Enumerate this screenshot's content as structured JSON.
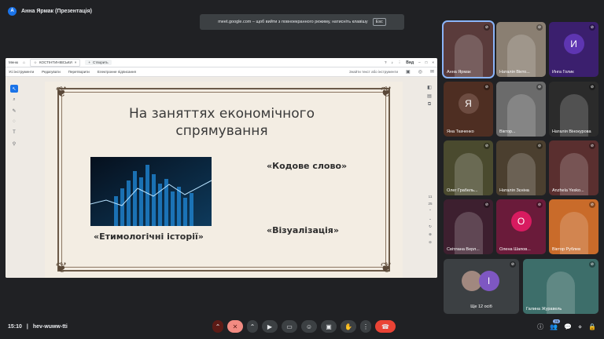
{
  "top": {
    "avatar_letter": "A",
    "presenter": "Анна Ярмак (Презентація)"
  },
  "banner": {
    "text": "meet.google.com – щоб вийти з повноекранного режиму, натисніть клавішу",
    "key": "Esc"
  },
  "browser": {
    "menu_label": "Меню",
    "tab_title": "КОСТІНТИНІВСЬКИ",
    "new_tab": "Створить",
    "view_label": "Вид",
    "menu_items": [
      "Усі інструменти",
      "Редагувати",
      "Перетворити",
      "Електронне підписання"
    ],
    "search_placeholder": "Знайти текст або інструменти",
    "page_current": "11",
    "page_total": "25"
  },
  "slide": {
    "title_line1": "На заняттях економічного",
    "title_line2": "спрямування",
    "caption_code": "«Кодове слово»",
    "caption_etym": "«Етимологічні історії»",
    "caption_visual": "«Візуалізація»"
  },
  "participants": [
    {
      "name": "Анна Ярмак",
      "type": "photo",
      "bg": "#5a3b3b"
    },
    {
      "name": "Наталія Вікто...",
      "type": "photo",
      "bg": "#8a7f72"
    },
    {
      "name": "Инга Голик",
      "type": "letter",
      "letter": "И",
      "bg": "#3b1f6e",
      "circle": "#5e35b1"
    },
    {
      "name": "Яна Ткаченко",
      "type": "letter",
      "letter": "Я",
      "bg": "#4e2e22",
      "circle": "#6d4c41"
    },
    {
      "name": "Віктор...",
      "type": "photo",
      "bg": "#6b6b6b"
    },
    {
      "name": "Наталія Вінокурова",
      "type": "photo",
      "bg": "#2b2b2b"
    },
    {
      "name": "Олег Грабель...",
      "type": "photo",
      "bg": "#4a4a2e"
    },
    {
      "name": "Наталія Зєніна",
      "type": "photo",
      "bg": "#4b3f2f"
    },
    {
      "name": "Anzhela Yesko...",
      "type": "photo",
      "bg": "#5a2f2f"
    },
    {
      "name": "Світлана Верл...",
      "type": "photo",
      "bg": "#3d1f2f"
    },
    {
      "name": "Олена Шапов...",
      "type": "letter",
      "letter": "О",
      "bg": "#6a1b3a",
      "circle": "#d81b60"
    },
    {
      "name": "Віктор Рублев",
      "type": "photo",
      "bg": "#c96b2a"
    },
    {
      "name": "Ще 12 осіб",
      "type": "more",
      "letter": "І",
      "bg": "#3c4043",
      "circle": "#7e57c2"
    },
    {
      "name": "Галина Журавель",
      "type": "photo",
      "bg": "#3d6e6a"
    }
  ],
  "bottom": {
    "time": "15:10",
    "meeting_code": "hev-wuww-tti",
    "people_count": "26"
  }
}
